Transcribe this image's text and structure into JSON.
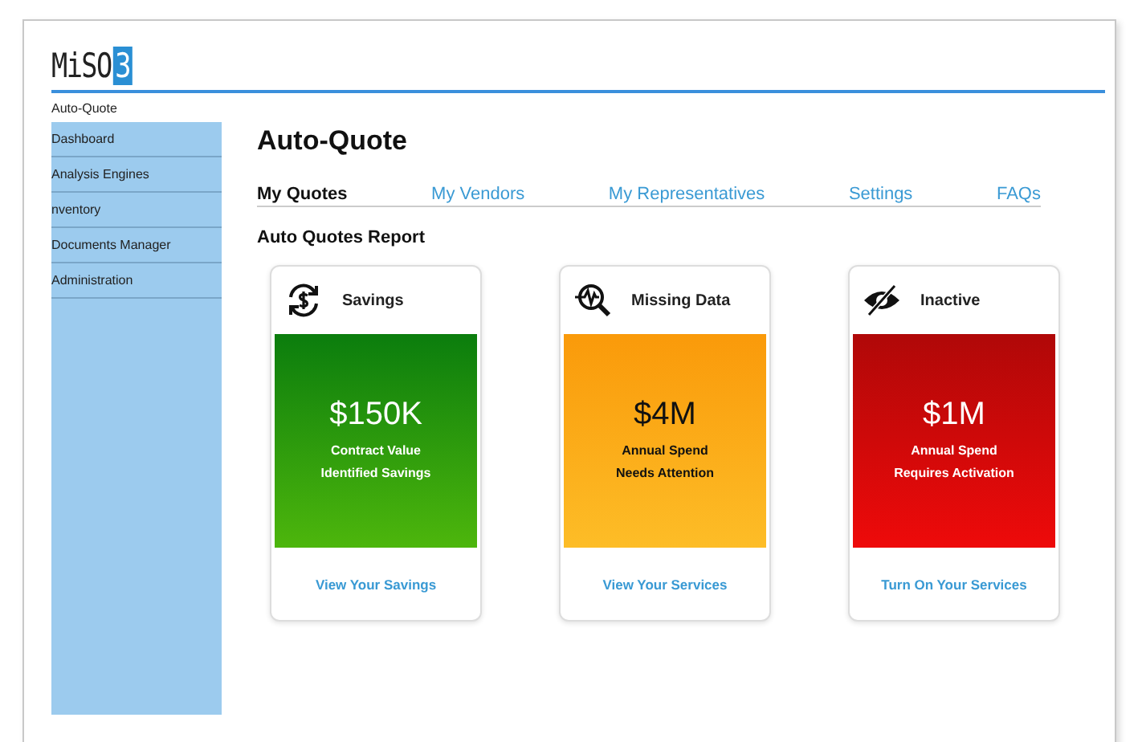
{
  "logo": {
    "text": "MiSO",
    "badge": "3"
  },
  "breadcrumb": "Auto-Quote",
  "sidebar": {
    "items": [
      {
        "label": "Dashboard"
      },
      {
        "label": "Analysis Engines"
      },
      {
        "label": "nventory"
      },
      {
        "label": "Documents Manager"
      },
      {
        "label": "Administration"
      }
    ]
  },
  "page_title": "Auto-Quote",
  "tabs": [
    {
      "label": "My Quotes",
      "selected": true
    },
    {
      "label": "My Vendors",
      "selected": false
    },
    {
      "label": "My Representatives",
      "selected": false
    },
    {
      "label": "Settings",
      "selected": false
    },
    {
      "label": "FAQs",
      "selected": false
    }
  ],
  "section_title": "Auto Quotes Report",
  "cards": [
    {
      "kind": "savings",
      "title": "Savings",
      "amount": "$150K",
      "line_1": "Contract Value",
      "line_2": "Identified Savings",
      "link": "View Your Savings"
    },
    {
      "kind": "missing",
      "title": "Missing Data",
      "amount": "$4M",
      "line_1": "Annual Spend",
      "line_2": "Needs Attention",
      "link": "View Your Services"
    },
    {
      "kind": "inactive",
      "title": "Inactive",
      "amount": "$1M",
      "line_1": "Annual Spend",
      "line_2": "Requires Activation",
      "link": "Turn On Your Services"
    }
  ]
}
